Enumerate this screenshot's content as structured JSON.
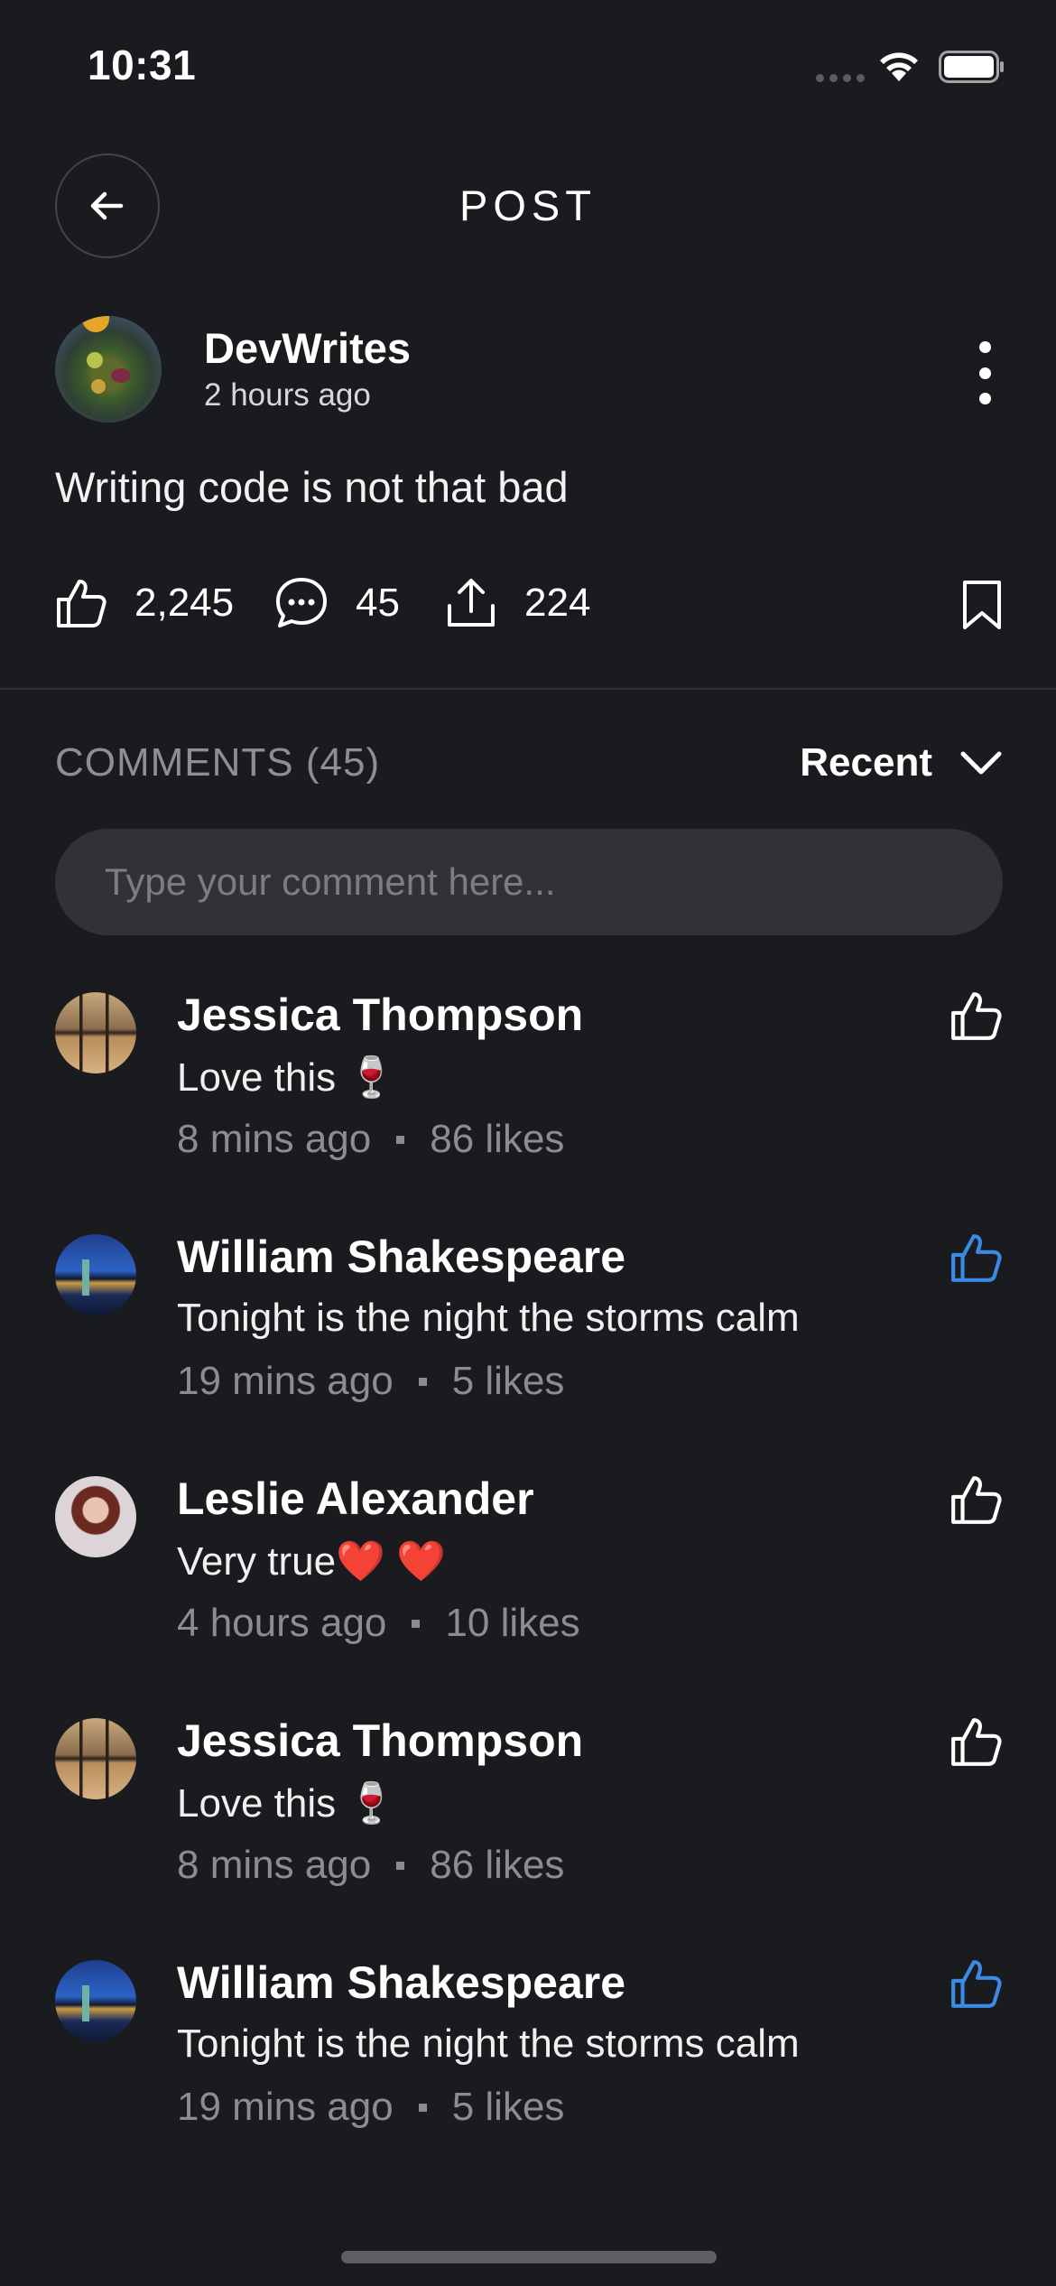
{
  "status_bar": {
    "time": "10:31"
  },
  "header": {
    "title": "POST"
  },
  "post": {
    "author": "DevWrites",
    "time": "2 hours ago",
    "body": "Writing code is not that bad",
    "likes": "2,245",
    "comments": "45",
    "shares": "224"
  },
  "comments_section": {
    "title": "COMMENTS (45)",
    "sort_label": "Recent",
    "input_placeholder": "Type your comment here..."
  },
  "comments": [
    {
      "name": "Jessica Thompson",
      "text": "Love this 🍷",
      "time": "8 mins ago",
      "likes": "86 likes",
      "liked": false
    },
    {
      "name": "William Shakespeare",
      "text": "Tonight is the night the storms calm",
      "time": "19 mins ago",
      "likes": "5 likes",
      "liked": true
    },
    {
      "name": "Leslie Alexander",
      "text": "Very true❤️ ❤️",
      "time": "4 hours ago",
      "likes": "10 likes",
      "liked": false
    },
    {
      "name": "Jessica Thompson",
      "text": "Love this 🍷",
      "time": "8 mins ago",
      "likes": "86 likes",
      "liked": false
    },
    {
      "name": "William Shakespeare",
      "text": "Tonight is the night the storms calm",
      "time": "19 mins ago",
      "likes": "5 likes",
      "liked": true
    }
  ],
  "colors": {
    "background": "#1a1b1e",
    "liked_accent": "#3b8be6",
    "muted_text": "#8c8d91",
    "input_background": "#313236"
  },
  "icons": [
    "back-arrow-icon",
    "wifi-icon",
    "battery-icon",
    "more-vertical-icon",
    "thumbs-up-icon",
    "comment-bubble-icon",
    "share-icon",
    "bookmark-icon",
    "chevron-down-icon"
  ]
}
